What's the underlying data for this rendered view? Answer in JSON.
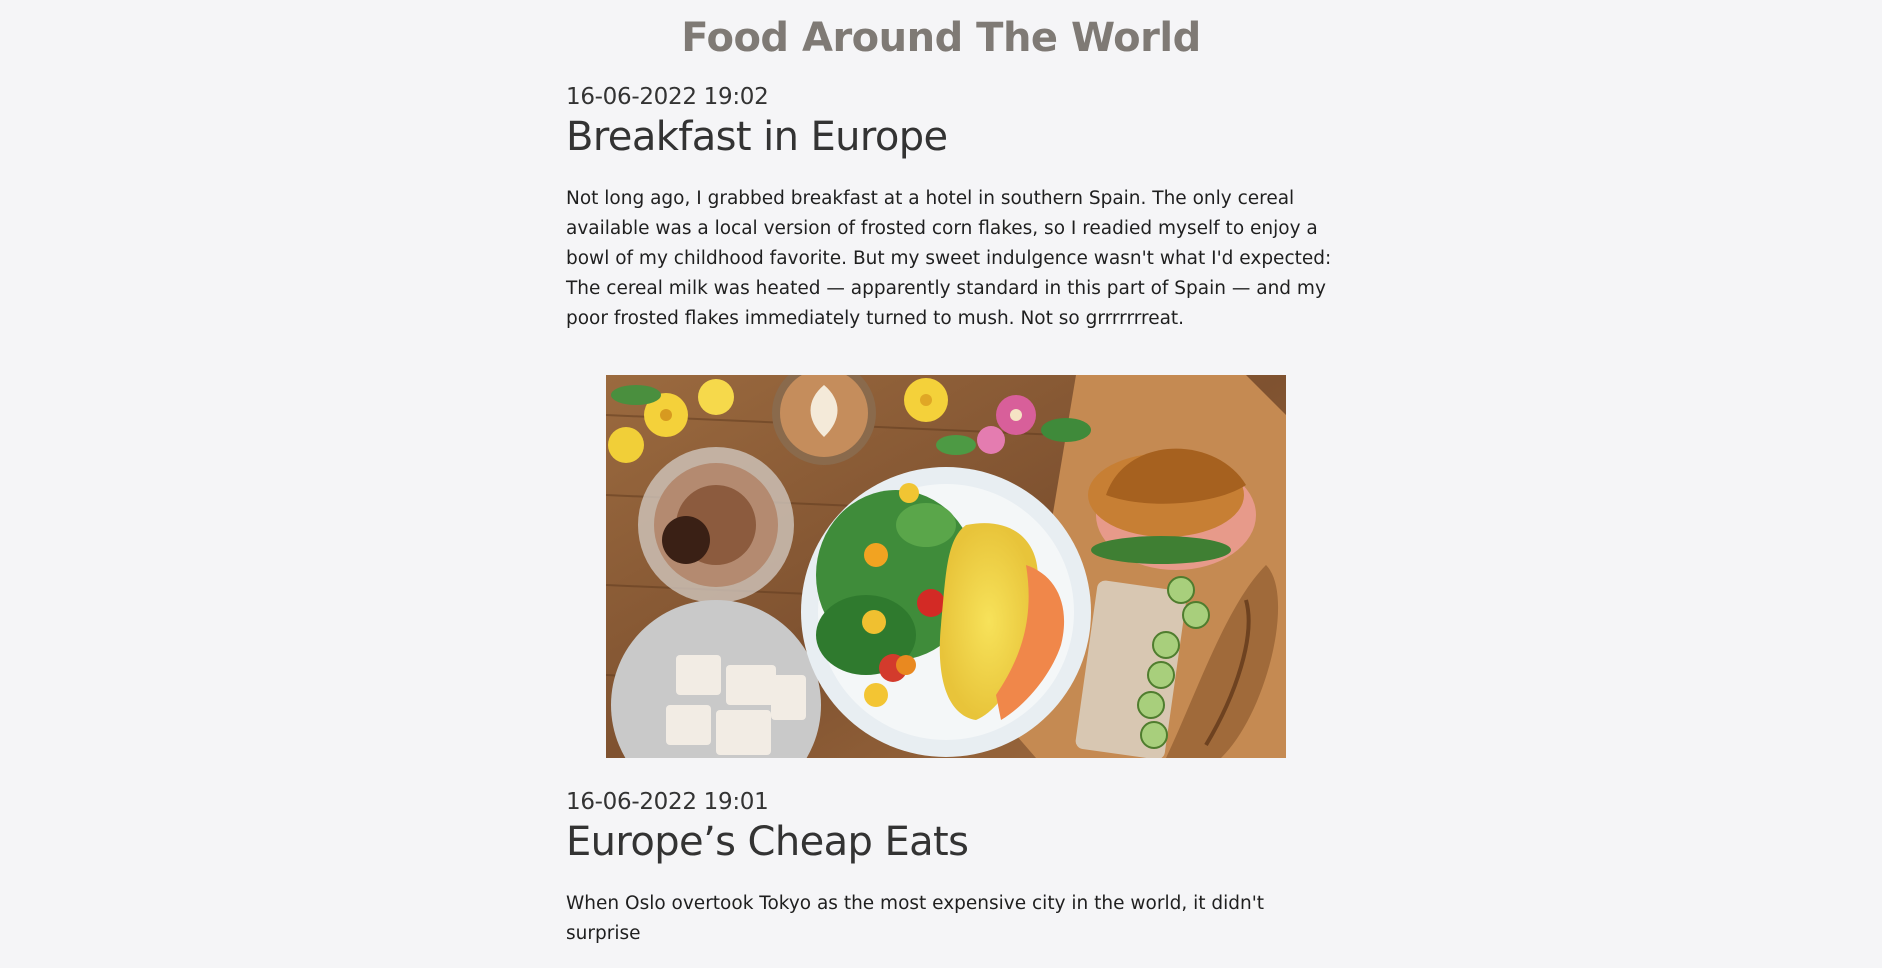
{
  "site": {
    "title": "Food Around The World"
  },
  "posts": [
    {
      "date": "16-06-2022 19:02",
      "title": "Breakfast in Europe",
      "body": "Not long ago, I grabbed breakfast at a hotel in southern Spain. The only cereal available was a local version of frosted corn flakes, so I readied myself to enjoy a bowl of my childhood favorite. But my sweet indulgence wasn't what I'd expected: The cereal milk was heated — apparently standard in this part of Spain — and my poor frosted flakes immediately turned to mush. Not so grrrrrrreat."
    },
    {
      "date": "16-06-2022 19:01",
      "title": "Europe’s Cheap Eats",
      "body": "When Oslo overtook Tokyo as the most expensive city in the world, it didn't surprise"
    }
  ],
  "colors": {
    "background": "#f5f5f7",
    "site_title": "#7f7a75",
    "text": "#333333",
    "table_wood": "#8a5a34"
  }
}
